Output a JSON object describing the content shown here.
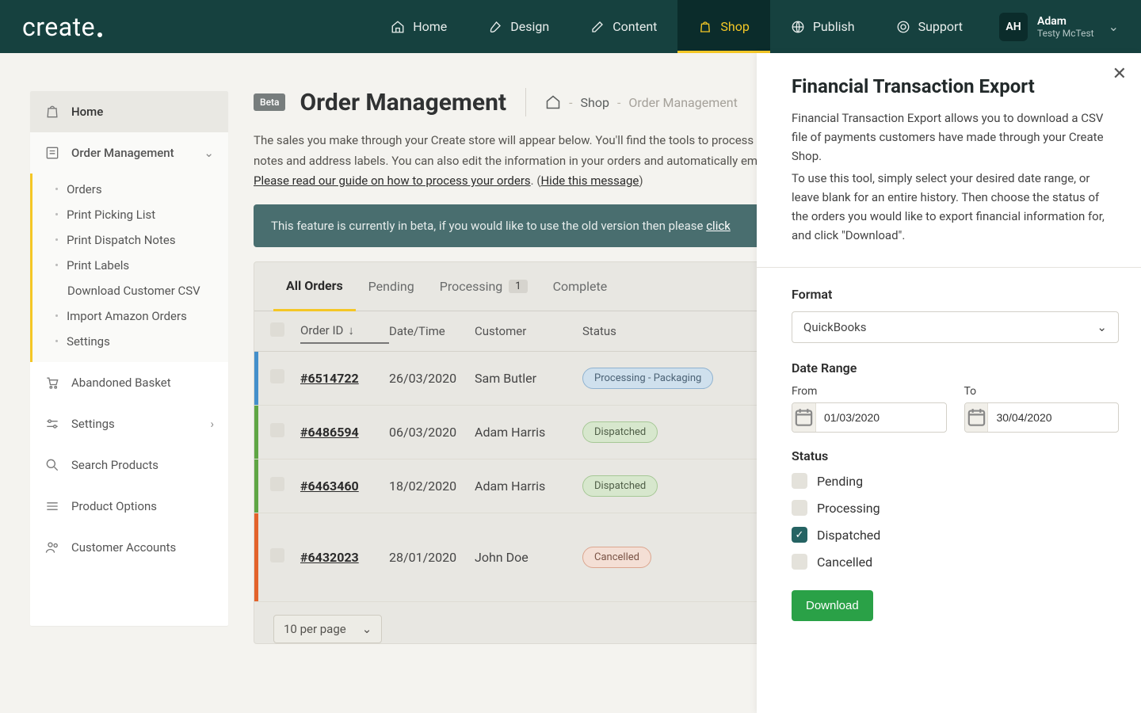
{
  "brand": "create",
  "nav": {
    "home": "Home",
    "design": "Design",
    "content": "Content",
    "shop": "Shop",
    "publish": "Publish",
    "support": "Support"
  },
  "user": {
    "initials": "AH",
    "name": "Adam",
    "sub": "Testy McTest"
  },
  "sidebar": {
    "home": "Home",
    "order_management": "Order Management",
    "subs": {
      "orders": "Orders",
      "picking": "Print Picking List",
      "dispatch": "Print Dispatch Notes",
      "labels": "Print Labels",
      "csv": "Download Customer CSV",
      "amazon": "Import Amazon Orders",
      "settings": "Settings"
    },
    "abandoned": "Abandoned Basket",
    "settings": "Settings",
    "search": "Search Products",
    "options": "Product Options",
    "custacc": "Customer Accounts"
  },
  "page": {
    "beta": "Beta",
    "title": "Order Management",
    "bc_shop": "Shop",
    "bc_here": "Order Management",
    "intro_line1": "The sales you make through your Create store will appear below. You'll find the tools to process and manage these orders including the ability to print dispatch notes and address labels. You can also edit the information in your orders and automatically email customers to let them know their order status.",
    "guide_prefix": "Please read our guide on how to process your orders",
    "guide_suffix_open": ". (",
    "hide": "Hide this message",
    "guide_suffix_close": ")",
    "beta_banner_a": "This feature is currently in beta, if you would like to use the old version then please ",
    "beta_banner_link": "click"
  },
  "tabs": {
    "all": "All Orders",
    "pending": "Pending",
    "processing": "Processing",
    "processing_count": "1",
    "complete": "Complete"
  },
  "thead": {
    "order": "Order ID",
    "dt": "Date/Time",
    "cust": "Customer",
    "status": "Status"
  },
  "rows": [
    {
      "id": "#6514722",
      "date": "26/03/2020",
      "cust": "Sam Butler",
      "status": "Processing - Packaging",
      "tone": "blue",
      "pill": "processing"
    },
    {
      "id": "#6486594",
      "date": "06/03/2020",
      "cust": "Adam Harris",
      "status": "Dispatched",
      "tone": "green",
      "pill": "dispatched"
    },
    {
      "id": "#6463460",
      "date": "18/02/2020",
      "cust": "Adam Harris",
      "status": "Dispatched",
      "tone": "green",
      "pill": "dispatched"
    },
    {
      "id": "#6432023",
      "date": "28/01/2020",
      "cust": "John Doe",
      "status": "Cancelled",
      "tone": "orange",
      "pill": "cancelled"
    }
  ],
  "pagesize": "10 per page",
  "drawer": {
    "title": "Financial Transaction Export",
    "p1": "Financial Transaction Export allows you to download a CSV file of payments customers have made through your Create Shop.",
    "p2": "To use this tool, simply select your desired date range, or leave blank for an entire history. Then choose the status of the orders you would like to export financial information for, and click \"Download\".",
    "format_label": "Format",
    "format_value": "QuickBooks",
    "daterange_label": "Date Range",
    "from_label": "From",
    "from_value": "01/03/2020",
    "to_label": "To",
    "to_value": "30/04/2020",
    "status_label": "Status",
    "statuses": {
      "pending": "Pending",
      "processing": "Processing",
      "dispatched": "Dispatched",
      "cancelled": "Cancelled"
    },
    "download": "Download"
  }
}
